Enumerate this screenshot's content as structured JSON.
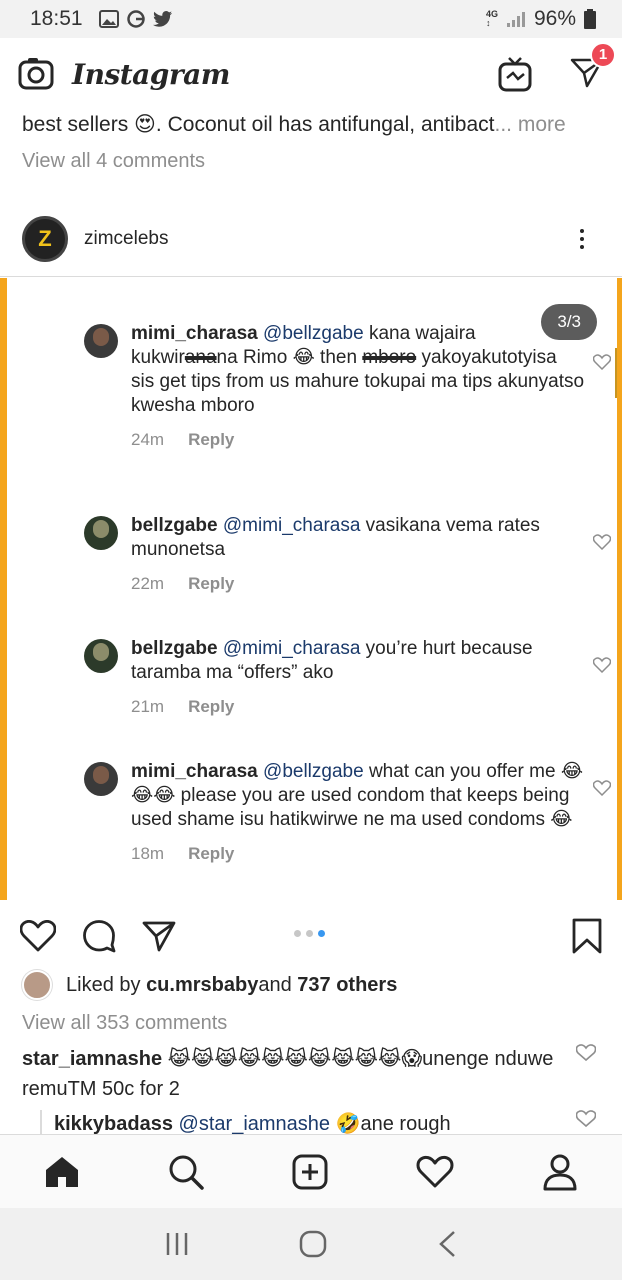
{
  "status": {
    "time": "18:51",
    "network": "4G",
    "battery": "96%"
  },
  "app": {
    "title": "Instagram",
    "dm_badge": "1"
  },
  "caption": {
    "text": "best sellers 😍. Coconut oil has antifungal, antibact",
    "ellipsis": "...",
    "more": " more"
  },
  "view_comments_top": "View all 4 comments",
  "post": {
    "username": "zimcelebs",
    "avatar_letter": "Z"
  },
  "image": {
    "counter": "3/3",
    "comments": [
      {
        "user": "mimi_charasa",
        "mention": "@bellzgabe",
        "text_a": " kana wajaira kukwir",
        "struck": "ana",
        "text_b": "na Rimo 😂  then ",
        "struck2": "mboro",
        "text_c": " yakoyakutotyisa sis get tips from us mahure tokupai ma tips akunyatso kwesha mboro",
        "time": "24m",
        "reply": "Reply"
      },
      {
        "user": "bellzgabe",
        "mention": "@mimi_charasa",
        "text": " vasikana vema rates munonetsa",
        "time": "22m",
        "reply": "Reply"
      },
      {
        "user": "bellzgabe",
        "mention": "@mimi_charasa",
        "text": " you’re hurt because taramba ma “offers” ako",
        "time": "21m",
        "reply": "Reply"
      },
      {
        "user": "mimi_charasa",
        "mention": "@bellzgabe",
        "text": " what can you offer me 😂😂😂 please you are used condom that keeps being used shame isu hatikwirwe ne ma used condoms 😂",
        "time": "18m",
        "reply": "Reply"
      }
    ]
  },
  "likes": {
    "prefix": "Liked by ",
    "user": "cu.mrsbaby",
    "mid": " and ",
    "others": "737 others"
  },
  "view_all": "View all 353 comments",
  "comment1": {
    "user": "star_iamnashe",
    "text": " 😹😹😹😹😹😹😹😹😹😹😱unenge nduwe remuTM 50c for 2"
  },
  "comment2": {
    "user": "kikkybadass",
    "mention": "@star_iamnashe",
    "text": " 🤣ane rough"
  },
  "colors": {
    "accent_border": "#f4a51c",
    "badge": "#ed4956",
    "dot_active": "#3897f0"
  },
  "icons": [
    "gallery-icon",
    "g-icon",
    "twitter-icon",
    "signal-icon",
    "battery-icon",
    "camera-icon",
    "igtv-icon",
    "direct-icon",
    "kebab-icon",
    "heart-icon",
    "comment-icon",
    "share-icon",
    "bookmark-icon",
    "home-icon",
    "search-icon",
    "add-icon",
    "activity-icon",
    "profile-icon",
    "recents-icon",
    "home-button-icon",
    "back-icon"
  ]
}
